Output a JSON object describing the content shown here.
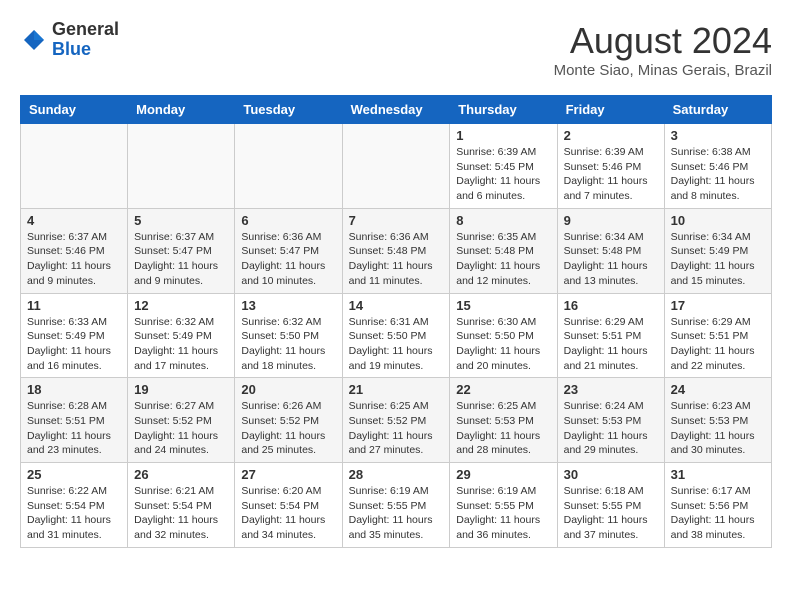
{
  "logo": {
    "general": "General",
    "blue": "Blue"
  },
  "header": {
    "month": "August 2024",
    "location": "Monte Siao, Minas Gerais, Brazil"
  },
  "weekdays": [
    "Sunday",
    "Monday",
    "Tuesday",
    "Wednesday",
    "Thursday",
    "Friday",
    "Saturday"
  ],
  "weeks": [
    [
      {
        "day": "",
        "info": ""
      },
      {
        "day": "",
        "info": ""
      },
      {
        "day": "",
        "info": ""
      },
      {
        "day": "",
        "info": ""
      },
      {
        "day": "1",
        "info": "Sunrise: 6:39 AM\nSunset: 5:45 PM\nDaylight: 11 hours\nand 6 minutes."
      },
      {
        "day": "2",
        "info": "Sunrise: 6:39 AM\nSunset: 5:46 PM\nDaylight: 11 hours\nand 7 minutes."
      },
      {
        "day": "3",
        "info": "Sunrise: 6:38 AM\nSunset: 5:46 PM\nDaylight: 11 hours\nand 8 minutes."
      }
    ],
    [
      {
        "day": "4",
        "info": "Sunrise: 6:37 AM\nSunset: 5:46 PM\nDaylight: 11 hours\nand 9 minutes."
      },
      {
        "day": "5",
        "info": "Sunrise: 6:37 AM\nSunset: 5:47 PM\nDaylight: 11 hours\nand 9 minutes."
      },
      {
        "day": "6",
        "info": "Sunrise: 6:36 AM\nSunset: 5:47 PM\nDaylight: 11 hours\nand 10 minutes."
      },
      {
        "day": "7",
        "info": "Sunrise: 6:36 AM\nSunset: 5:48 PM\nDaylight: 11 hours\nand 11 minutes."
      },
      {
        "day": "8",
        "info": "Sunrise: 6:35 AM\nSunset: 5:48 PM\nDaylight: 11 hours\nand 12 minutes."
      },
      {
        "day": "9",
        "info": "Sunrise: 6:34 AM\nSunset: 5:48 PM\nDaylight: 11 hours\nand 13 minutes."
      },
      {
        "day": "10",
        "info": "Sunrise: 6:34 AM\nSunset: 5:49 PM\nDaylight: 11 hours\nand 15 minutes."
      }
    ],
    [
      {
        "day": "11",
        "info": "Sunrise: 6:33 AM\nSunset: 5:49 PM\nDaylight: 11 hours\nand 16 minutes."
      },
      {
        "day": "12",
        "info": "Sunrise: 6:32 AM\nSunset: 5:49 PM\nDaylight: 11 hours\nand 17 minutes."
      },
      {
        "day": "13",
        "info": "Sunrise: 6:32 AM\nSunset: 5:50 PM\nDaylight: 11 hours\nand 18 minutes."
      },
      {
        "day": "14",
        "info": "Sunrise: 6:31 AM\nSunset: 5:50 PM\nDaylight: 11 hours\nand 19 minutes."
      },
      {
        "day": "15",
        "info": "Sunrise: 6:30 AM\nSunset: 5:50 PM\nDaylight: 11 hours\nand 20 minutes."
      },
      {
        "day": "16",
        "info": "Sunrise: 6:29 AM\nSunset: 5:51 PM\nDaylight: 11 hours\nand 21 minutes."
      },
      {
        "day": "17",
        "info": "Sunrise: 6:29 AM\nSunset: 5:51 PM\nDaylight: 11 hours\nand 22 minutes."
      }
    ],
    [
      {
        "day": "18",
        "info": "Sunrise: 6:28 AM\nSunset: 5:51 PM\nDaylight: 11 hours\nand 23 minutes."
      },
      {
        "day": "19",
        "info": "Sunrise: 6:27 AM\nSunset: 5:52 PM\nDaylight: 11 hours\nand 24 minutes."
      },
      {
        "day": "20",
        "info": "Sunrise: 6:26 AM\nSunset: 5:52 PM\nDaylight: 11 hours\nand 25 minutes."
      },
      {
        "day": "21",
        "info": "Sunrise: 6:25 AM\nSunset: 5:52 PM\nDaylight: 11 hours\nand 27 minutes."
      },
      {
        "day": "22",
        "info": "Sunrise: 6:25 AM\nSunset: 5:53 PM\nDaylight: 11 hours\nand 28 minutes."
      },
      {
        "day": "23",
        "info": "Sunrise: 6:24 AM\nSunset: 5:53 PM\nDaylight: 11 hours\nand 29 minutes."
      },
      {
        "day": "24",
        "info": "Sunrise: 6:23 AM\nSunset: 5:53 PM\nDaylight: 11 hours\nand 30 minutes."
      }
    ],
    [
      {
        "day": "25",
        "info": "Sunrise: 6:22 AM\nSunset: 5:54 PM\nDaylight: 11 hours\nand 31 minutes."
      },
      {
        "day": "26",
        "info": "Sunrise: 6:21 AM\nSunset: 5:54 PM\nDaylight: 11 hours\nand 32 minutes."
      },
      {
        "day": "27",
        "info": "Sunrise: 6:20 AM\nSunset: 5:54 PM\nDaylight: 11 hours\nand 34 minutes."
      },
      {
        "day": "28",
        "info": "Sunrise: 6:19 AM\nSunset: 5:55 PM\nDaylight: 11 hours\nand 35 minutes."
      },
      {
        "day": "29",
        "info": "Sunrise: 6:19 AM\nSunset: 5:55 PM\nDaylight: 11 hours\nand 36 minutes."
      },
      {
        "day": "30",
        "info": "Sunrise: 6:18 AM\nSunset: 5:55 PM\nDaylight: 11 hours\nand 37 minutes."
      },
      {
        "day": "31",
        "info": "Sunrise: 6:17 AM\nSunset: 5:56 PM\nDaylight: 11 hours\nand 38 minutes."
      }
    ]
  ]
}
